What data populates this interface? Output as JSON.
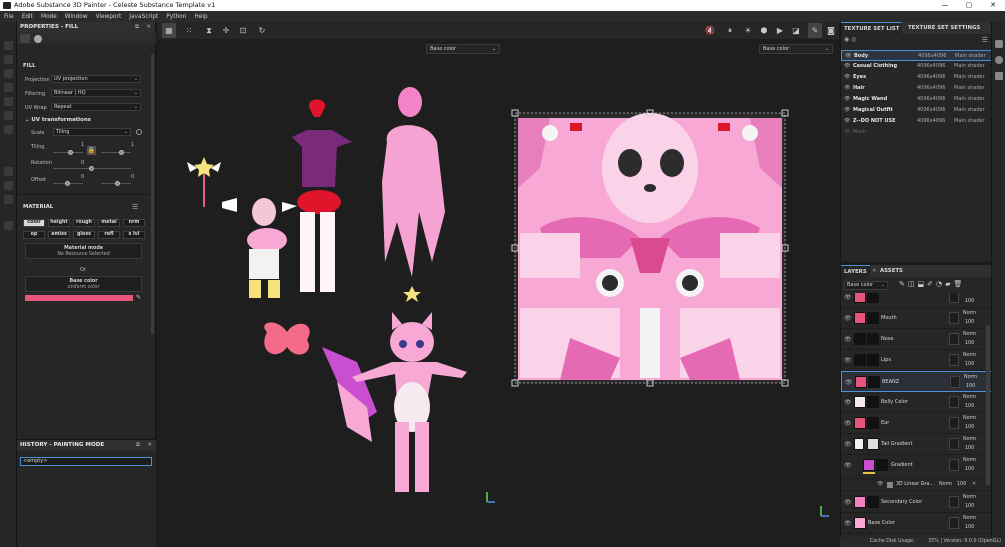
{
  "window": {
    "title": "Adobe Substance 3D Painter - Celeste Substance Template v1",
    "min": "—",
    "max": "▢",
    "close": "✕"
  },
  "menu": [
    "File",
    "Edit",
    "Mode",
    "Window",
    "Viewport",
    "JavaScript",
    "Python",
    "Help"
  ],
  "properties": {
    "title": "PROPERTIES - FILL",
    "section_fill": "FILL",
    "projection_label": "Projection",
    "projection_value": "UV projection",
    "filtering_label": "Filtering",
    "filtering_value": "Bilinear | HQ",
    "uvwrap_label": "UV Wrap",
    "uvwrap_value": "Repeat",
    "uv_transform_label": "UV transformations",
    "scale_label": "Scale",
    "scale_value": "Tiling",
    "tiling_label": "Tiling",
    "tiling_val1": "1",
    "tiling_val2": "1",
    "rotation_label": "Rotation",
    "rotation_val": "0",
    "offset_label": "Offset",
    "offset_val1": "0",
    "offset_val2": "0",
    "section_material": "MATERIAL",
    "channels": [
      "color",
      "height",
      "rough",
      "metal",
      "nrm",
      "op",
      "emiss",
      "gloss",
      "refl",
      "s lvl"
    ],
    "material_mode_title": "Material mode",
    "material_mode_sub": "No Resource Selected",
    "or_text": "Or",
    "base_color_title": "Base color",
    "base_color_sub": "uniform color",
    "base_color_hex": "#e8547a"
  },
  "history": {
    "title": "HISTORY - PAINTING MODE",
    "entry": "<empty>"
  },
  "viewport": {
    "left_channel": "Base color",
    "right_channel": "Base color"
  },
  "texture_sets": {
    "tab_list": "TEXTURE SET LIST",
    "tab_settings": "TEXTURE SET SETTINGS",
    "rows": [
      {
        "name": "Body",
        "res": "4096x4096",
        "shader": "Main shader"
      },
      {
        "name": "Casual Clothing",
        "res": "4096x4096",
        "shader": "Main shader"
      },
      {
        "name": "Eyes",
        "res": "4096x4096",
        "shader": "Main shader"
      },
      {
        "name": "Hair",
        "res": "4096x4096",
        "shader": "Main shader"
      },
      {
        "name": "Magic Wand",
        "res": "4096x4096",
        "shader": "Main shader"
      },
      {
        "name": "Magical Outfit",
        "res": "4096x4096",
        "shader": "Main shader"
      },
      {
        "name": "Z--DO NOT USE",
        "res": "4096x4096",
        "shader": "Main shader"
      },
      {
        "name": "Mesh",
        "res": "",
        "shader": ""
      }
    ]
  },
  "layers": {
    "tab_layers": "LAYERS",
    "tab_assets": "ASSETS",
    "channel": "Base color",
    "rows": [
      {
        "name": "",
        "blend": "",
        "op": "100",
        "color": "#e8547a"
      },
      {
        "name": "Mouth",
        "blend": "Norm",
        "op": "100",
        "color": "#e8547a"
      },
      {
        "name": "Nose",
        "blend": "Norm",
        "op": "100",
        "color": "#111111"
      },
      {
        "name": "Lips",
        "blend": "Norm",
        "op": "100",
        "color": "#111111"
      },
      {
        "name": "BEANZ",
        "blend": "Norm",
        "op": "100",
        "color": "#e8547a"
      },
      {
        "name": "Belly Color",
        "blend": "Norm",
        "op": "100",
        "color": "#f6e9ef"
      },
      {
        "name": "Ear",
        "blend": "Norm",
        "op": "100",
        "color": "#e8547a"
      },
      {
        "name": "Tail Gradient",
        "blend": "Norm",
        "op": "100",
        "color": "#f0f0f0"
      },
      {
        "name": "Gradient",
        "blend": "Norm",
        "op": "100",
        "color": "#c94fd0"
      },
      {
        "name": "3D Linear Gra...",
        "blend": "Norm",
        "op": "100",
        "color": "#888888"
      },
      {
        "name": "Secondary Color",
        "blend": "Norm",
        "op": "100",
        "color": "#f27fbf"
      },
      {
        "name": "Base Color",
        "blend": "Norm",
        "op": "100",
        "color": "#f7a8d4"
      }
    ]
  },
  "status": {
    "cache": "Cache Disk Usage:",
    "cache_val": "35%",
    "version": "Version: 9.0.0 (OpenGL)"
  }
}
